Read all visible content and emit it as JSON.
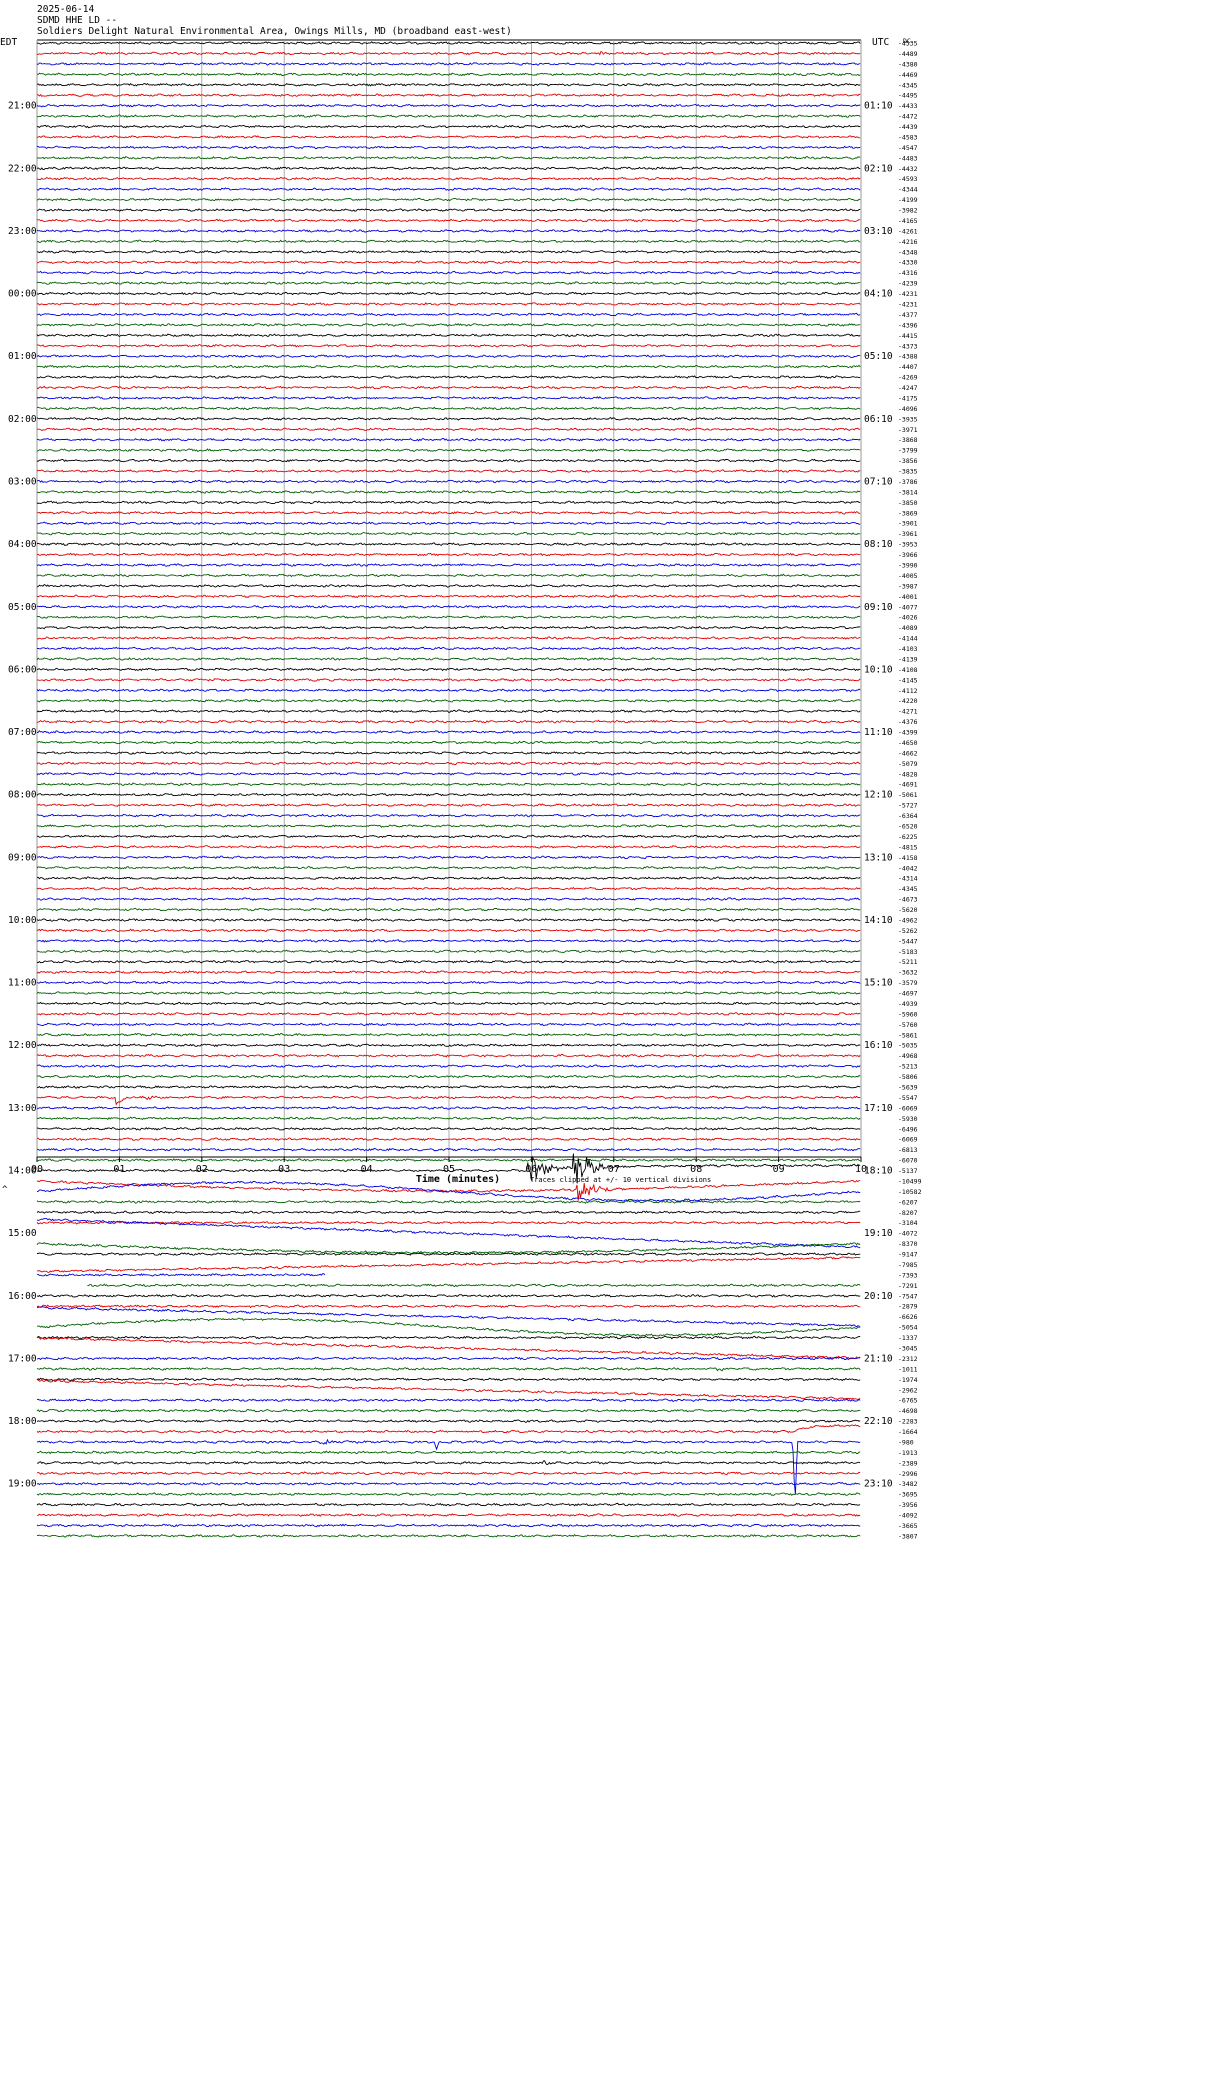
{
  "header": {
    "date": "2025-06-14",
    "station": "SDMD HHE LD --",
    "location": "Soldiers Delight Natural Environmental Area, Owings Mills, MD (broadband east-west)"
  },
  "labels": {
    "left_tz": "EDT",
    "right_tz": "UTC",
    "right_top": "DC",
    "xlabel": "Time (minutes)",
    "note": "Traces clipped at +/- 10 vertical divisions",
    "corner_mark": "^"
  },
  "colors": {
    "cycle": [
      "#000000",
      "#e00000",
      "#0000e0",
      "#006000"
    ],
    "grid": "#999999"
  },
  "chart_data": {
    "type": "line",
    "title": "",
    "xlabel": "Time (minutes)",
    "xlim": [
      0,
      10
    ],
    "x_ticks": [
      "00",
      "01",
      "02",
      "03",
      "04",
      "05",
      "06",
      "07",
      "08",
      "09",
      "10"
    ],
    "trace_count": 144,
    "trace_minutes": 10,
    "left_hour_labels": [
      "21:00",
      "22:00",
      "23:00",
      "00:00",
      "01:00",
      "02:00",
      "03:00",
      "04:00",
      "05:00",
      "06:00",
      "07:00",
      "08:00",
      "09:00",
      "10:00",
      "11:00",
      "12:00",
      "13:00",
      "14:00",
      "15:00",
      "16:00",
      "17:00",
      "18:00",
      "19:00"
    ],
    "right_hour_labels": [
      "01:10",
      "02:10",
      "03:10",
      "04:10",
      "05:10",
      "06:10",
      "07:10",
      "08:10",
      "09:10",
      "10:10",
      "11:10",
      "12:10",
      "13:10",
      "14:10",
      "15:10",
      "16:10",
      "17:10",
      "18:10",
      "19:10",
      "20:10",
      "21:10",
      "22:10",
      "23:10"
    ],
    "hour_label_first_trace": 6,
    "hour_label_every": 6,
    "trace_counts": [
      "-4535",
      "-4489",
      "-4380",
      "-4469",
      "-4345",
      "-4495",
      "-4433",
      "-4472",
      "-4439",
      "-4583",
      "-4547",
      "-4483",
      "-4432",
      "-4593",
      "-4344",
      "-4199",
      "-3982",
      "-4165",
      "-4261",
      "-4216",
      "-4348",
      "-4330",
      "-4316",
      "-4239",
      "-4231",
      "-4231",
      "-4377",
      "-4396",
      "-4415",
      "-4373",
      "-4388",
      "-4407",
      "-4269",
      "-4247",
      "-4175",
      "-4096",
      "-3935",
      "-3971",
      "-3868",
      "-3799",
      "-3856",
      "-3835",
      "-3786",
      "-3814",
      "-3850",
      "-3869",
      "-3901",
      "-3961",
      "-3953",
      "-3966",
      "-3990",
      "-4005",
      "-3987",
      "-4001",
      "-4077",
      "-4026",
      "-4089",
      "-4144",
      "-4103",
      "-4139",
      "-4108",
      "-4145",
      "-4112",
      "-4220",
      "-4271",
      "-4376",
      "-4399",
      "-4650",
      "-4662",
      "-5079",
      "-4828",
      "-4691",
      "-5061",
      "-5727",
      "-6364",
      "-6520",
      "-6225",
      "-4815",
      "-4158",
      "-4042",
      "-4314",
      "-4345",
      "-4673",
      "-5620",
      "-4962",
      "-5262",
      "-5447",
      "-5183",
      "-5211",
      "-3632",
      "-3579",
      "-4697",
      "-4939",
      "-5960",
      "-5760",
      "-5861",
      "-5035",
      "-4968",
      "-5213",
      "-5806",
      "-5639",
      "-5547",
      "-6069",
      "-5930",
      "-6496",
      "-6069",
      "-6813",
      "-6070",
      "-5137",
      "-10499",
      "-10582",
      "-6207",
      "-8207",
      "-3104",
      "-4072",
      "-8370",
      "-9147",
      "-7985",
      "-7393",
      "-7291",
      "-7547",
      "-2879",
      "-6626",
      "-5054",
      "-1337",
      "-3045",
      "-2312",
      "-1011",
      "-1974",
      "-2962",
      "-6765",
      "-4698",
      "-2283",
      "-1664",
      "-980",
      "-1913",
      "-2389",
      "-2996",
      "-3482",
      "-3695",
      "-3956",
      "-4092",
      "-3665",
      "-3807"
    ],
    "events": [
      {
        "trace": 1,
        "minute": 6.85,
        "kind": "burst",
        "amp": 2
      },
      {
        "trace": 16,
        "minute": 9.55,
        "kind": "burst",
        "amp": 2.5
      },
      {
        "trace": 101,
        "minute": 0.95,
        "kind": "step",
        "amp": 7
      },
      {
        "trace": 101,
        "minute": 1.35,
        "kind": "burst",
        "amp": 2
      },
      {
        "trace": 108,
        "minute": 6.0,
        "kind": "quake",
        "amp": 30
      },
      {
        "trace": 108,
        "minute": 6.55,
        "kind": "quake",
        "amp": 40
      },
      {
        "trace": 109,
        "minute": 6.6,
        "kind": "quake",
        "amp": 25
      },
      {
        "trace": 127,
        "minute": 8.3,
        "kind": "burst",
        "amp": 3
      },
      {
        "trace": 134,
        "minute": 9.2,
        "kind": "spike",
        "amp": 60
      },
      {
        "trace": 134,
        "minute": 3.5,
        "kind": "burst",
        "amp": 3
      },
      {
        "trace": 134,
        "minute": 4.85,
        "kind": "spike",
        "amp": 8
      },
      {
        "trace": 136,
        "minute": 6.15,
        "kind": "burst",
        "amp": 4
      }
    ],
    "drifts": [
      {
        "trace": 108,
        "from": 6.0,
        "to": 10.0,
        "amp": -5,
        "shape": "plateau"
      },
      {
        "trace": 109,
        "from": 0.0,
        "to": 10.0,
        "amp": 10,
        "shape": "dip"
      },
      {
        "trace": 110,
        "from": 0.0,
        "to": 10.0,
        "amp": -9,
        "shape": "wave"
      },
      {
        "trace": 114,
        "from": 0.0,
        "to": 10.0,
        "amp": -14,
        "shape": "rise"
      },
      {
        "trace": 115,
        "from": 0.0,
        "to": 10.0,
        "amp": 9,
        "shape": "dip"
      },
      {
        "trace": 117,
        "from": 0.0,
        "to": 10.0,
        "amp": 7,
        "shape": "rise"
      },
      {
        "trace": 122,
        "from": 0.0,
        "to": 10.0,
        "amp": 9,
        "shape": "fall"
      },
      {
        "trace": 123,
        "from": 0.0,
        "to": 10.0,
        "amp": -8,
        "shape": "wave"
      },
      {
        "trace": 125,
        "from": 0.0,
        "to": 10.0,
        "amp": 10,
        "shape": "fall"
      },
      {
        "trace": 129,
        "from": 0.0,
        "to": 10.0,
        "amp": -9,
        "shape": "rise"
      },
      {
        "trace": 133,
        "from": 9.2,
        "to": 10.0,
        "amp": -6,
        "shape": "plateau"
      }
    ],
    "gaps": [
      {
        "trace": 118,
        "from": 3.5,
        "to": 10.0
      },
      {
        "trace": 119,
        "from": 0.0,
        "to": 0.6
      }
    ]
  }
}
